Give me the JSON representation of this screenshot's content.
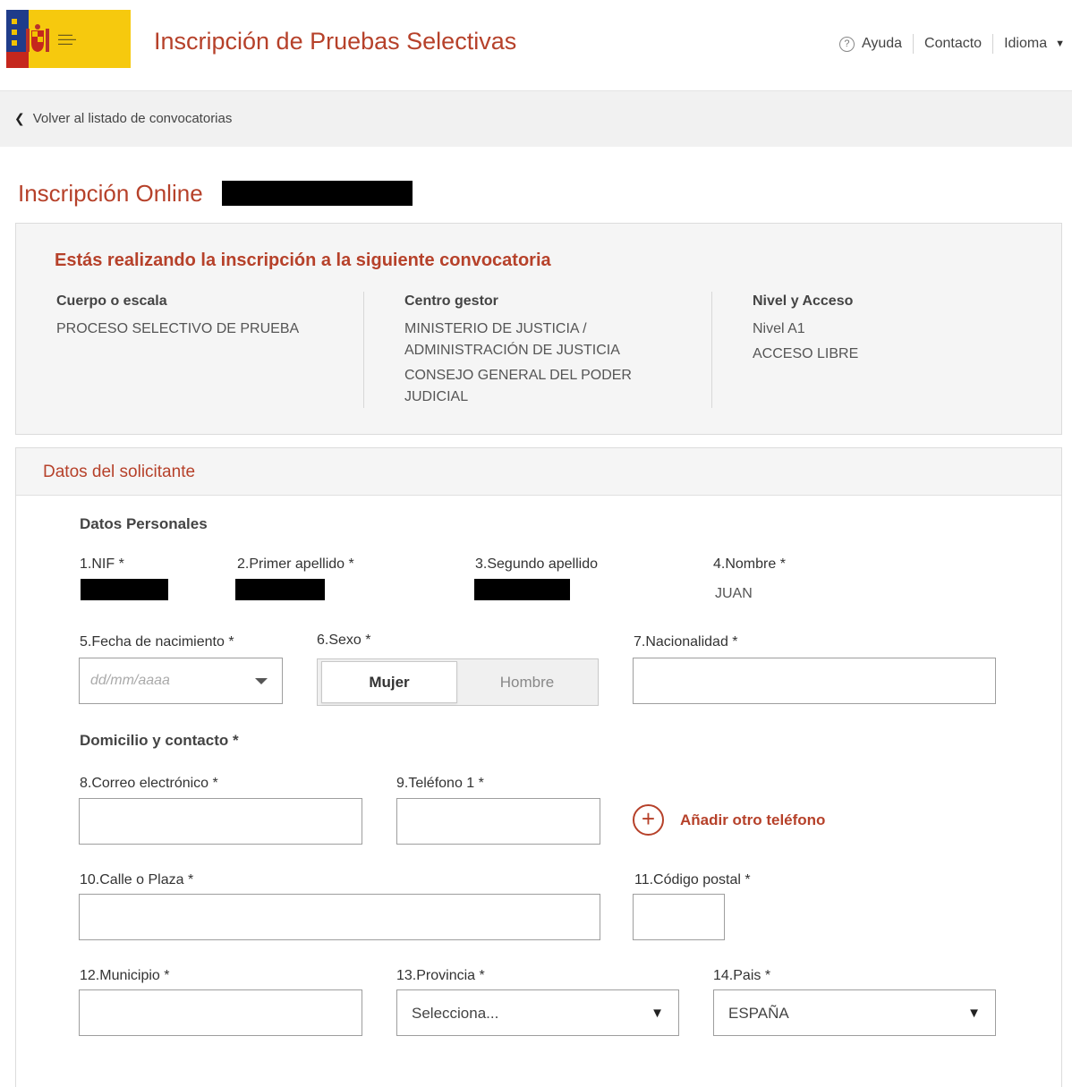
{
  "header": {
    "app_title": "Inscripción de Pruebas Selectivas",
    "nav": {
      "help": "Ayuda",
      "contact": "Contacto",
      "language": "Idioma"
    },
    "icons": {
      "help": "help-circle-icon",
      "language_caret": "caret-down-icon"
    }
  },
  "breadcrumb": {
    "back_label": "Volver al listado de convocatorias"
  },
  "page": {
    "title": "Inscripción Online"
  },
  "convocatoria": {
    "heading": "Estás realizando la inscripción a la siguiente convocatoria",
    "cuerpo": {
      "label": "Cuerpo o escala",
      "value": "PROCESO SELECTIVO DE PRUEBA"
    },
    "centro": {
      "label": "Centro gestor",
      "lines": [
        "MINISTERIO DE JUSTICIA /",
        "ADMINISTRACIÓN DE JUSTICIA",
        "CONSEJO GENERAL DEL PODER",
        "JUDICIAL"
      ]
    },
    "nivel": {
      "label": "Nivel y Acceso",
      "lines": [
        "Nivel A1",
        "ACCESO LIBRE"
      ]
    }
  },
  "solicitante": {
    "section_title": "Datos del solicitante",
    "personal": {
      "heading": "Datos Personales",
      "nif_label": "1.NIF *",
      "apellido1_label": "2.Primer apellido *",
      "apellido2_label": "3.Segundo apellido",
      "nombre_label": "4.Nombre *",
      "nombre_value": "JUAN",
      "fecha_label": "5.Fecha de nacimiento *",
      "fecha_placeholder": "dd/mm/aaaa",
      "sexo_label": "6.Sexo *",
      "sexo_options": [
        "Mujer",
        "Hombre"
      ],
      "sexo_selected": "Mujer",
      "nacionalidad_label": "7.Nacionalidad *"
    },
    "contacto": {
      "heading": "Domicilio y contacto *",
      "email_label": "8.Correo electrónico *",
      "telefono_label": "9.Teléfono 1 *",
      "add_phone": "Añadir otro teléfono",
      "calle_label": "10.Calle o Plaza *",
      "cp_label": "11.Código postal *",
      "municipio_label": "12.Municipio *",
      "provincia_label": "13.Provincia *",
      "provincia_value": "Selecciona...",
      "pais_label": "14.Pais *",
      "pais_value": "ESPAÑA"
    }
  },
  "colors": {
    "accent": "#b6412a",
    "gov_blue": "#1f3c8a",
    "gov_yellow": "#f6c90e",
    "gov_red": "#c5271d"
  }
}
